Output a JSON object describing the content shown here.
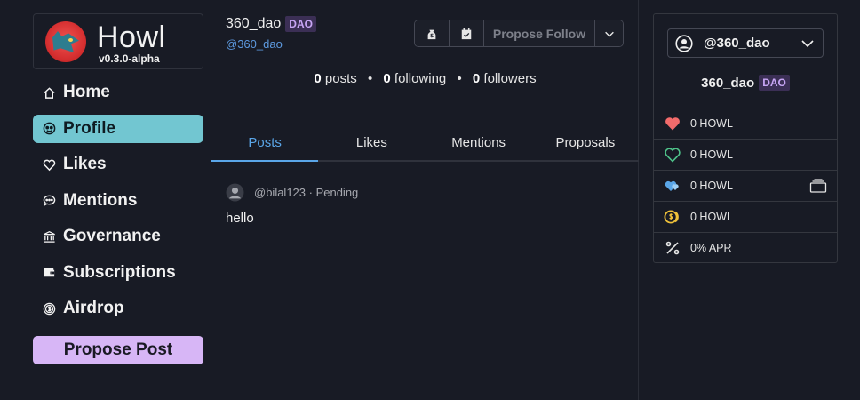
{
  "brand": {
    "title": "Howl",
    "version": "v0.3.0-alpha"
  },
  "nav": [
    {
      "label": "Home",
      "icon": "home-icon"
    },
    {
      "label": "Profile",
      "icon": "profile-icon",
      "active": true
    },
    {
      "label": "Likes",
      "icon": "heart-icon"
    },
    {
      "label": "Mentions",
      "icon": "chat-icon"
    },
    {
      "label": "Governance",
      "icon": "bank-icon"
    },
    {
      "label": "Subscriptions",
      "icon": "wallet-icon"
    },
    {
      "label": "Airdrop",
      "icon": "coin-icon"
    }
  ],
  "propose_post_label": "Propose Post",
  "profile": {
    "name": "360_dao",
    "badge": "DAO",
    "handle": "@360_dao",
    "propose_follow_label": "Propose Follow",
    "stats": {
      "posts_count": "0",
      "posts_label": "posts",
      "following_count": "0",
      "following_label": "following",
      "followers_count": "0",
      "followers_label": "followers"
    }
  },
  "tabs": [
    "Posts",
    "Likes",
    "Mentions",
    "Proposals"
  ],
  "active_tab": "Posts",
  "post": {
    "author": "@bilal123",
    "status": "Pending",
    "meta": "@bilal123 · Pending",
    "body": "hello"
  },
  "account": {
    "selected": "@360_dao",
    "name": "360_dao",
    "badge": "DAO",
    "rows": [
      {
        "icon": "heart-filled-icon",
        "value": "0 HOWL",
        "color": "#f26b6b"
      },
      {
        "icon": "heart-outline-icon",
        "value": "0 HOWL",
        "color": "#4fc38a"
      },
      {
        "icon": "hearts-icon",
        "value": "0 HOWL",
        "color": "#5aa6e8"
      },
      {
        "icon": "coins-icon",
        "value": "0 HOWL",
        "color": "#f0c23a"
      },
      {
        "icon": "percent-icon",
        "value": "0% APR",
        "color": "#e6e6e6"
      }
    ]
  }
}
